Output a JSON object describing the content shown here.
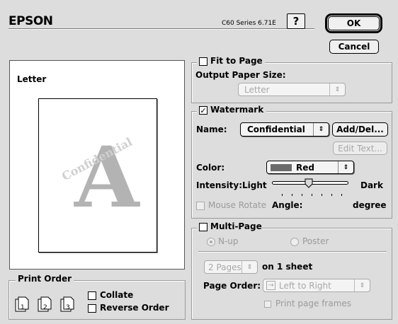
{
  "header": {
    "brand": "EPSON",
    "version": "C60 Series 6.71E",
    "help_icon": "?",
    "ok_label": "OK",
    "cancel_label": "Cancel"
  },
  "preview": {
    "paper_label": "Letter",
    "watermark_letter": "A",
    "watermark_text": "Confidential"
  },
  "print_order": {
    "title": "Print Order",
    "collate_label": "Collate",
    "reverse_label": "Reverse Order",
    "icon_pages": [
      "1",
      "2",
      "3"
    ],
    "collate_checked": false,
    "reverse_checked": false
  },
  "fit_to_page": {
    "label": "Fit to Page",
    "checked": false,
    "output_label": "Output Paper Size:",
    "output_value": "Letter"
  },
  "watermark": {
    "label": "Watermark",
    "checked": true,
    "checkmark": "✓",
    "name_label": "Name:",
    "name_value": "Confidential",
    "add_del_label": "Add/Del...",
    "edit_text_label": "Edit Text...",
    "color_label": "Color:",
    "color_value": "Red",
    "swatch_color": "#6b6b6b",
    "intensity_label": "Intensity:",
    "intensity_light": "Light",
    "intensity_dark": "Dark",
    "intensity_value": 0.5,
    "mouse_rotate_label": "Mouse Rotate",
    "angle_label": "Angle:",
    "angle_unit": "degree"
  },
  "multi_page": {
    "label": "Multi-Page",
    "checked": false,
    "nup_label": "N-up",
    "poster_label": "Poster",
    "pages_value": "2 Pages",
    "pages_suffix": "on 1 sheet",
    "page_order_label": "Page Order:",
    "page_order_value": "Left to Right",
    "page_order_icon": "→",
    "print_frames_label": "Print page frames"
  }
}
